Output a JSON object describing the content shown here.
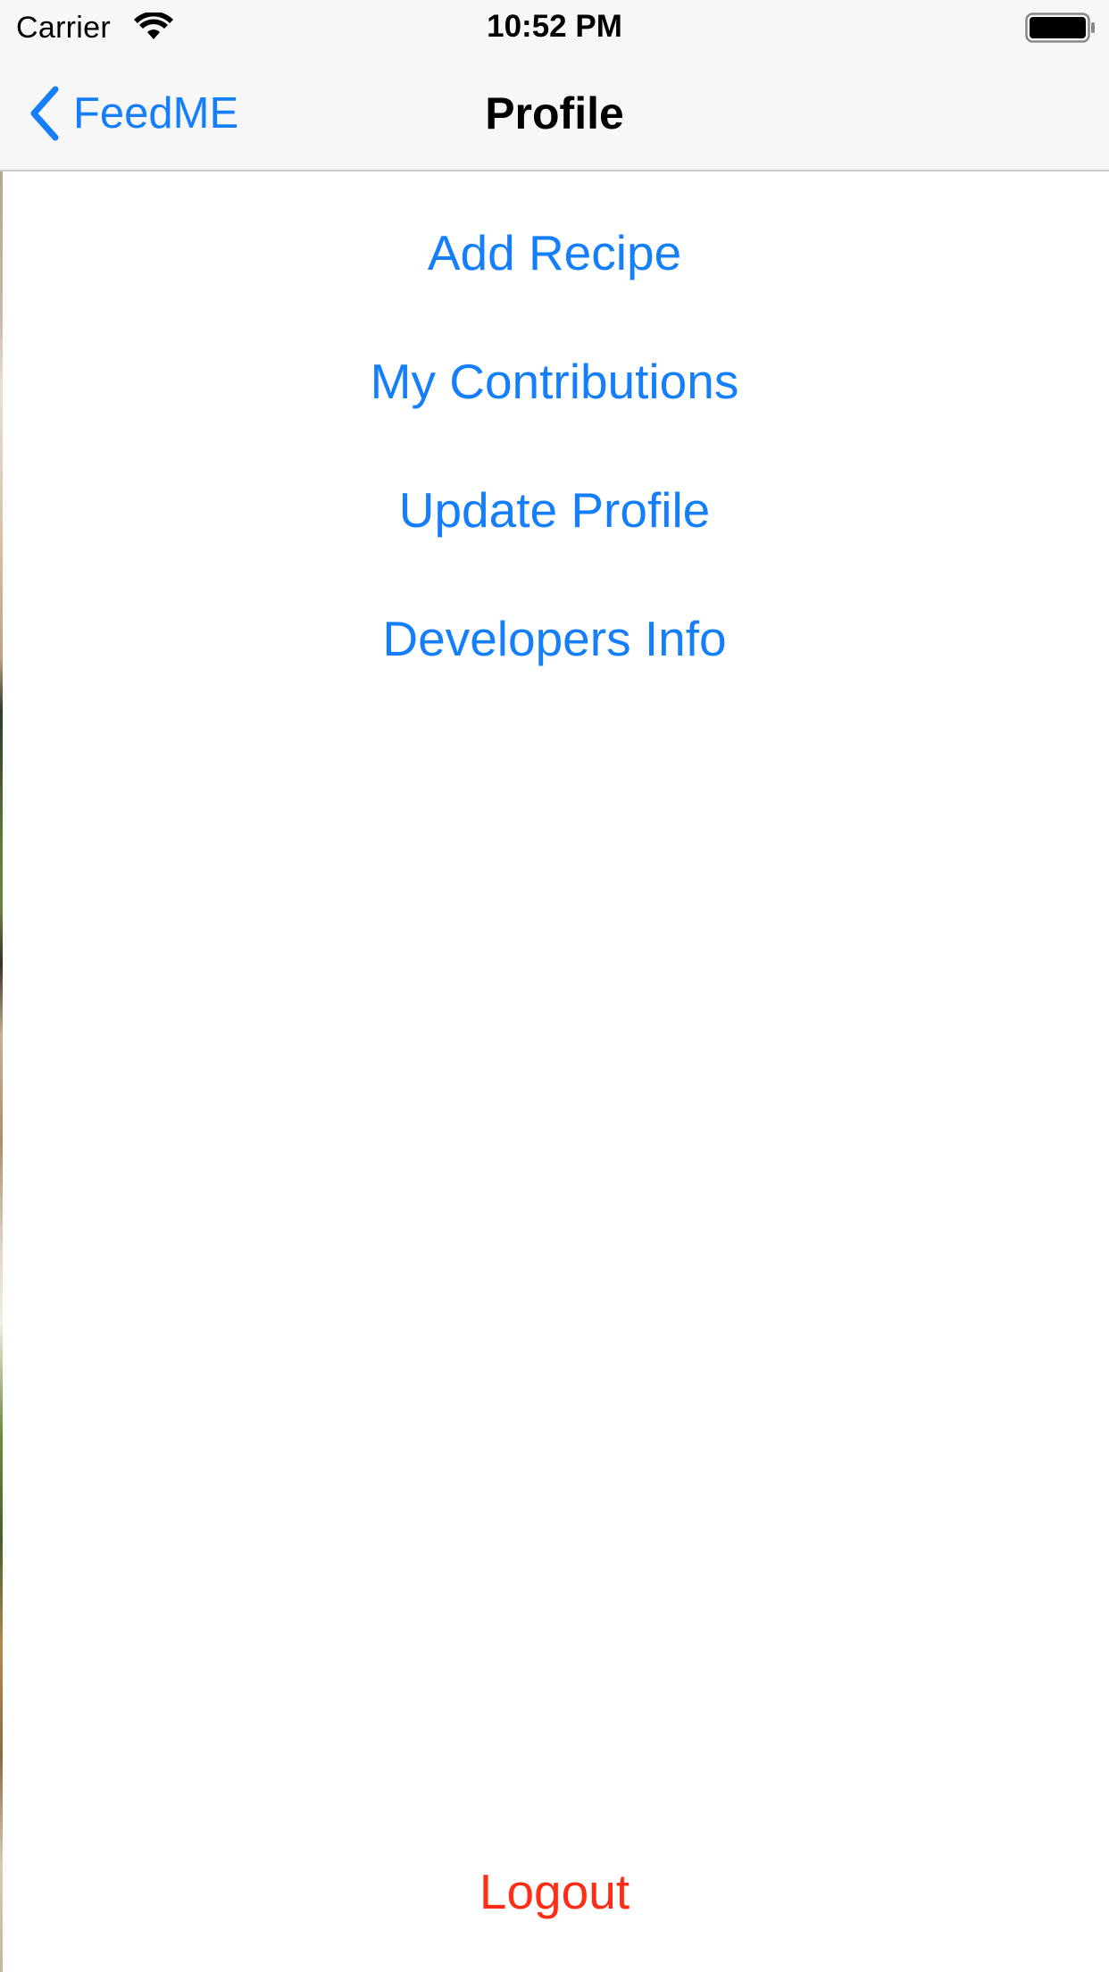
{
  "status_bar": {
    "carrier": "Carrier",
    "time": "10:52 PM",
    "icons": [
      "wifi-icon",
      "battery-icon"
    ]
  },
  "nav": {
    "back_label": "FeedME",
    "title": "Profile",
    "back_icon": "chevron-left-icon"
  },
  "menu": {
    "add_recipe": "Add Recipe",
    "my_contributions": "My Contributions",
    "update_profile": "Update Profile",
    "developers_info": "Developers Info",
    "logout": "Logout"
  },
  "colors": {
    "accent": "#147efb",
    "destructive": "#ff2d16",
    "bar_background": "#f7f7f7"
  }
}
